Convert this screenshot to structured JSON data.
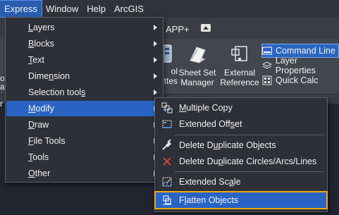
{
  "menubar": {
    "items": [
      {
        "label": "Express",
        "active": true
      },
      {
        "label": "Window"
      },
      {
        "label": "Help"
      },
      {
        "label": "ArcGIS"
      }
    ]
  },
  "ribbon": {
    "tab_visible": "APP+",
    "left_strip": [
      "o",
      "a",
      "r"
    ],
    "big_tools": [
      {
        "line1": "ol",
        "line2": "ettes",
        "icon": "tool-palettes-icon"
      },
      {
        "line1": "Sheet Set",
        "line2": "Manager",
        "icon": "sheet-set-manager-icon"
      },
      {
        "line1": "External",
        "line2": "Reference",
        "icon": "external-reference-icon"
      }
    ],
    "small_tools": [
      {
        "label": "Command Line",
        "icon": "command-line-icon",
        "selected": true
      },
      {
        "label": "Layer Properties",
        "icon": "layer-properties-icon"
      },
      {
        "label": "Quick Calc",
        "icon": "quick-calc-icon"
      }
    ]
  },
  "express_menu": {
    "items": [
      {
        "pre": "",
        "ul": "L",
        "post": "ayers"
      },
      {
        "pre": "",
        "ul": "B",
        "post": "locks"
      },
      {
        "pre": "",
        "ul": "T",
        "post": "ext"
      },
      {
        "pre": "Dime",
        "ul": "n",
        "post": "sion"
      },
      {
        "pre": "Selection tool",
        "ul": "s",
        "post": ""
      },
      {
        "pre": "",
        "ul": "M",
        "post": "odify"
      },
      {
        "pre": "",
        "ul": "D",
        "post": "raw"
      },
      {
        "pre": "",
        "ul": "F",
        "post": "ile Tools"
      },
      {
        "pre": "",
        "ul": "T",
        "post": "ools"
      },
      {
        "pre": "",
        "ul": "O",
        "post": "ther"
      }
    ]
  },
  "modify_submenu": {
    "items": [
      {
        "pre": "",
        "ul": "M",
        "post": "ultiple Copy",
        "icon": "multiple-copy-icon"
      },
      {
        "pre": "Extended Off",
        "ul": "s",
        "post": "et",
        "icon": "extended-offset-icon"
      },
      {
        "pre": "Delete D",
        "ul": "u",
        "post": "plicate Objects",
        "icon": "delete-duplicate-objects-icon"
      },
      {
        "pre": "Delete Du",
        "ul": "p",
        "post": "licate Circles/Arcs/Lines",
        "icon": "delete-duplicate-circles-icon"
      },
      {
        "pre": "Extended Sc",
        "ul": "a",
        "post": "le",
        "icon": "extended-scale-icon"
      },
      {
        "pre": "F",
        "ul": "l",
        "post": "atten Objects",
        "icon": "flatten-objects-icon"
      }
    ]
  },
  "colors": {
    "accent": "#2964c4",
    "highlight_outline": "#f2a516"
  }
}
